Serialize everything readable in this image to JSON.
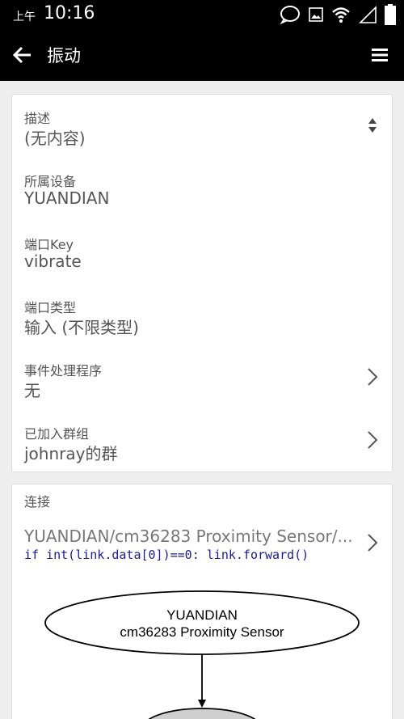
{
  "status_bar": {
    "time_prefix": "上午",
    "time": "10:16",
    "icons": [
      "message-icon",
      "image-icon",
      "wifi-icon",
      "signal-icon",
      "battery-icon"
    ]
  },
  "app_bar": {
    "title": "振动",
    "back_icon": "back-arrow-icon",
    "menu_icon": "menu-icon"
  },
  "details": {
    "description": {
      "label": "描述",
      "value": "(无内容)"
    },
    "device": {
      "label": "所属设备",
      "value": "YUANDIAN"
    },
    "port_key": {
      "label": "端口Key",
      "value": "vibrate"
    },
    "port_type": {
      "label": "端口类型",
      "value": "输入 (不限类型)"
    },
    "event_handler": {
      "label": "事件处理程序",
      "value": "无"
    },
    "group": {
      "label": "已加入群组",
      "value": "johnray的群"
    }
  },
  "connections": {
    "label": "连接",
    "link_text": "YUANDIAN/cm36283 Proximity Sensor/...",
    "code": "if int(link.data[0])==0: link.forward()",
    "graph": {
      "source_line1": "YUANDIAN",
      "source_line2": "cm36283  Proximity Sensor"
    }
  }
}
